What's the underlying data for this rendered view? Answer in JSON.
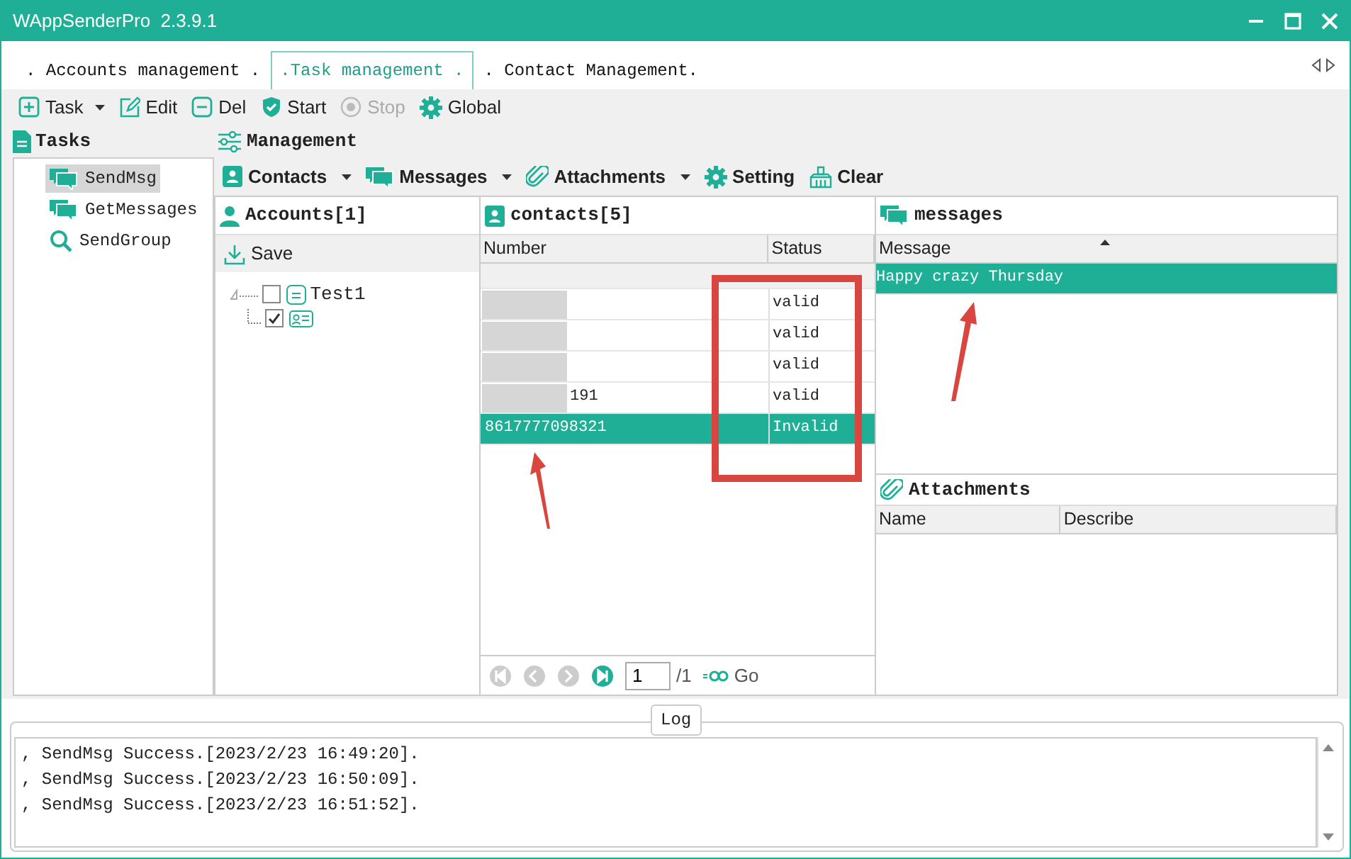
{
  "window": {
    "title": "WAppSenderPro",
    "version": "2.3.9.1"
  },
  "tabs": [
    {
      "label": ". Accounts management .",
      "selected": false
    },
    {
      "label": ".Task management .",
      "selected": true
    },
    {
      "label": ". Contact Management.",
      "selected": false
    }
  ],
  "toolbar": [
    {
      "label": "Task",
      "dropdown": true,
      "disabled": false
    },
    {
      "label": "Edit",
      "dropdown": false,
      "disabled": false
    },
    {
      "label": "Del",
      "dropdown": false,
      "disabled": false
    },
    {
      "label": "Start",
      "dropdown": false,
      "disabled": false
    },
    {
      "label": "Stop",
      "dropdown": false,
      "disabled": true
    },
    {
      "label": "Global",
      "dropdown": false,
      "disabled": false
    }
  ],
  "sidebar": {
    "title": "Tasks",
    "items": [
      {
        "label": "SendMsg",
        "selected": true
      },
      {
        "label": "GetMessages",
        "selected": false
      },
      {
        "label": "SendGroup",
        "selected": false
      }
    ]
  },
  "management": {
    "title": "Management",
    "toolbar": [
      {
        "label": "Contacts",
        "dropdown": true
      },
      {
        "label": "Messages",
        "dropdown": true
      },
      {
        "label": "Attachments",
        "dropdown": true
      },
      {
        "label": "Setting",
        "dropdown": false
      },
      {
        "label": "Clear",
        "dropdown": false
      }
    ]
  },
  "accounts": {
    "title": "Accounts[1]",
    "save": "Save",
    "tree": [
      {
        "label": "Test1",
        "checked": false,
        "children": [
          {
            "checked": true
          }
        ]
      }
    ]
  },
  "contacts": {
    "title": "contacts[5]",
    "columns": [
      "Number",
      "Status"
    ],
    "rows": [
      {
        "status": "valid",
        "selected": false
      },
      {
        "status": "valid",
        "selected": false
      },
      {
        "status": "valid",
        "selected": false
      },
      {
        "number": "191",
        "status": "valid",
        "selected": false
      },
      {
        "number": "8617777098321",
        "status": "Invalid",
        "selected": true
      }
    ],
    "pager": {
      "page": "1",
      "total": "/1",
      "go": "Go"
    }
  },
  "messages": {
    "title": "messages",
    "columns": [
      "Message"
    ],
    "rows": [
      {
        "text": "Happy crazy Thursday",
        "selected": true
      }
    ]
  },
  "attachments": {
    "title": "Attachments",
    "columns": [
      "Name",
      "Describe"
    ]
  },
  "log": {
    "title": "Log",
    "lines": [
      ", SendMsg Success.[2023/2/23 16:49:20].",
      ", SendMsg Success.[2023/2/23 16:50:09].",
      ", SendMsg Success.[2023/2/23 16:51:52]."
    ]
  }
}
